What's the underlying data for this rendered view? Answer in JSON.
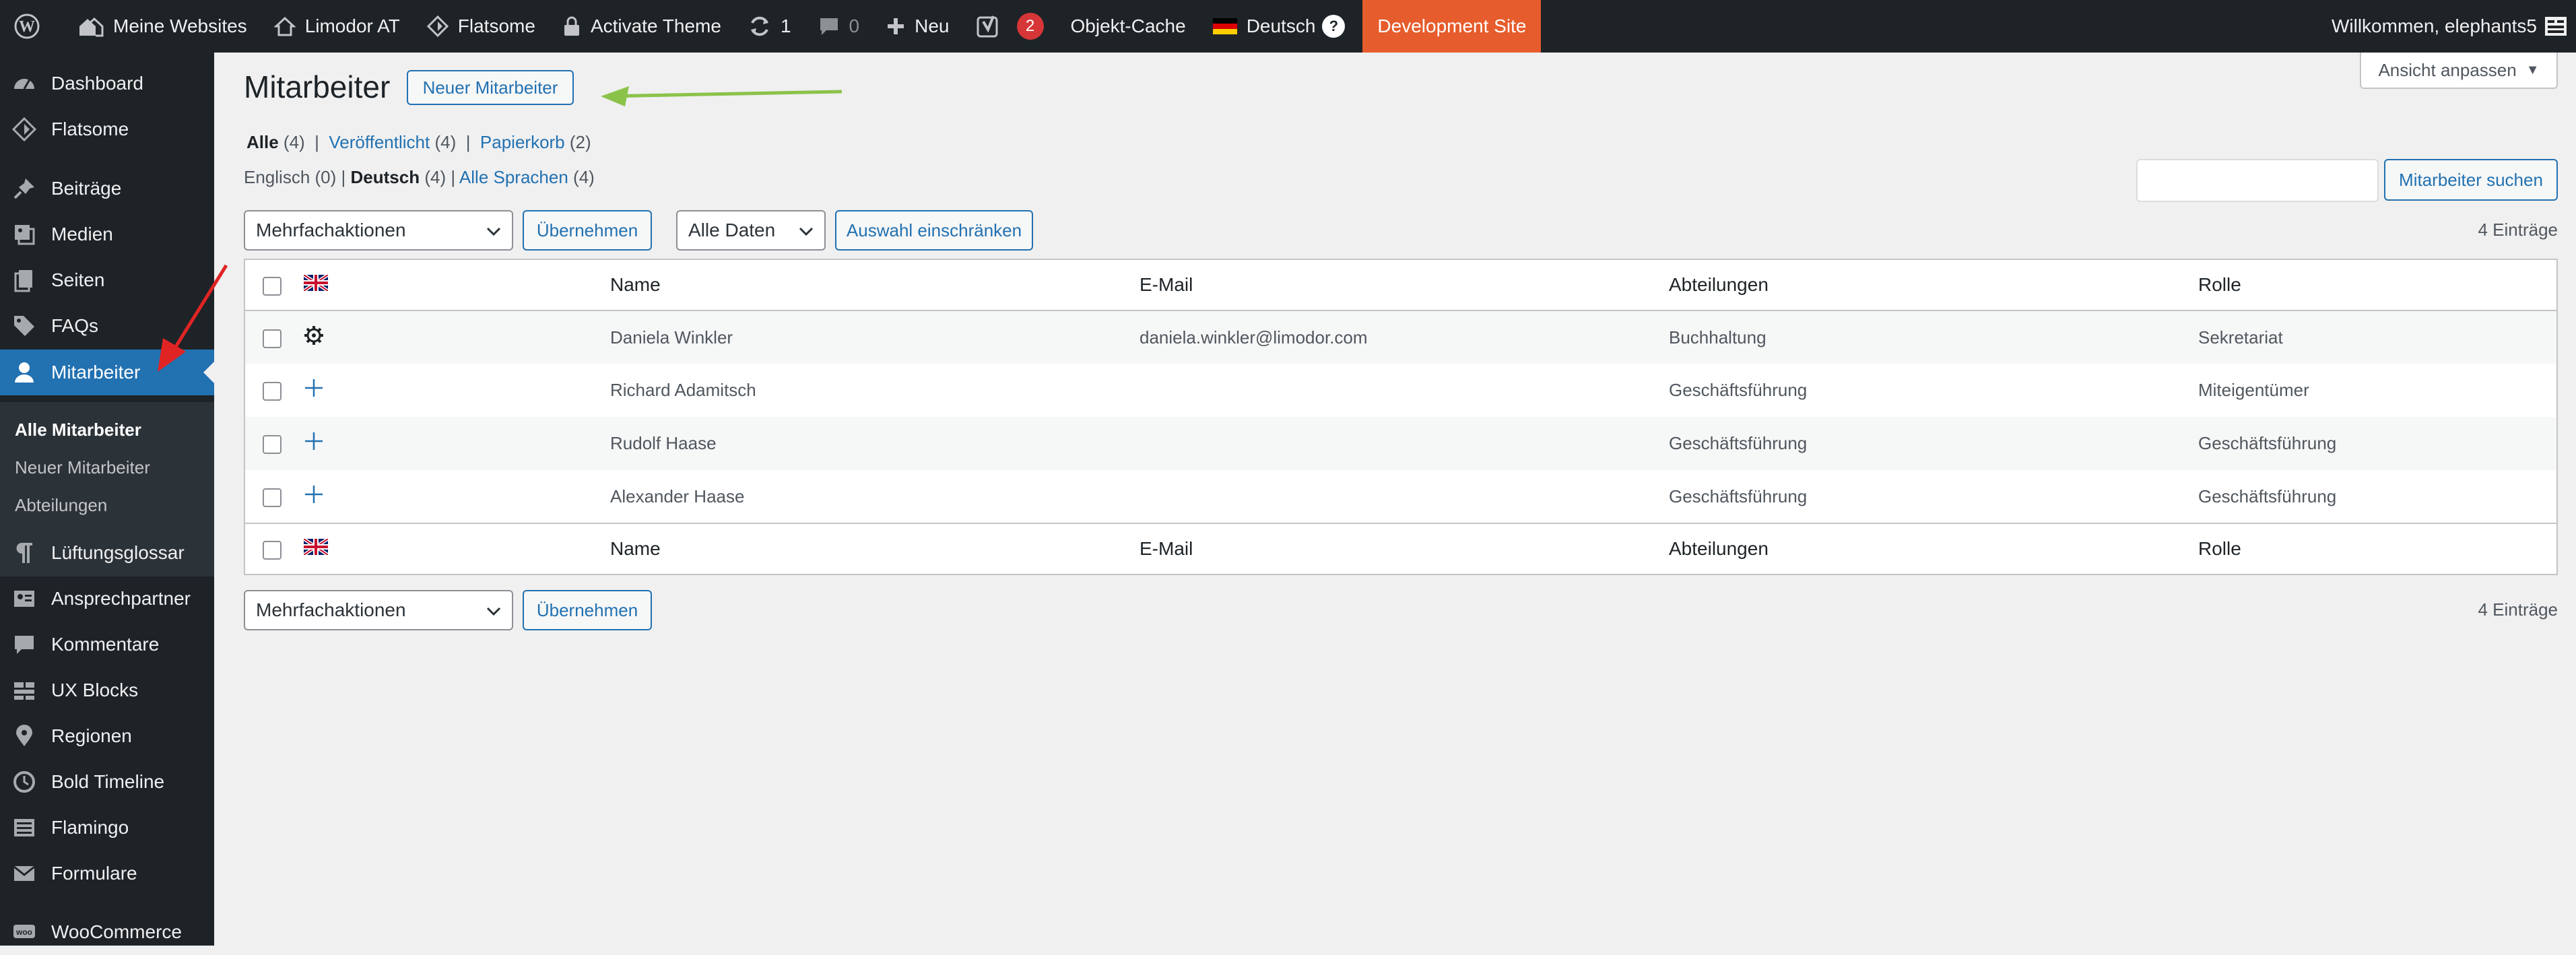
{
  "admin_bar": {
    "my_sites": "Meine Websites",
    "site_name": "Limodor AT",
    "theme": "Flatsome",
    "activate_theme": "Activate Theme",
    "updates_count": "1",
    "comments_count": "0",
    "new_label": "Neu",
    "yoast_badge": "2",
    "object_cache": "Objekt-Cache",
    "language": "Deutsch",
    "language_help": "?",
    "dev_site": "Development Site",
    "welcome": "Willkommen, elephants5",
    "dev_color": "#e65c2c"
  },
  "sidebar": {
    "items": [
      {
        "label": "Dashboard",
        "icon": "dashboard-icon"
      },
      {
        "label": "Flatsome",
        "icon": "flatsome-icon"
      },
      {
        "label": "Beiträge",
        "icon": "pin-icon"
      },
      {
        "label": "Medien",
        "icon": "media-icon"
      },
      {
        "label": "Seiten",
        "icon": "pages-icon"
      },
      {
        "label": "FAQs",
        "icon": "tag-icon"
      },
      {
        "label": "Mitarbeiter",
        "icon": "user-icon",
        "current": true
      },
      {
        "label": "Lüftungsglossar",
        "icon": "paragraph-icon"
      },
      {
        "label": "Ansprechpartner",
        "icon": "contacts-icon"
      },
      {
        "label": "Kommentare",
        "icon": "comment-icon"
      },
      {
        "label": "UX Blocks",
        "icon": "blocks-icon"
      },
      {
        "label": "Regionen",
        "icon": "location-icon"
      },
      {
        "label": "Bold Timeline",
        "icon": "clock-icon"
      },
      {
        "label": "Flamingo",
        "icon": "list-icon"
      },
      {
        "label": "Formulare",
        "icon": "mail-icon"
      },
      {
        "label": "WooCommerce",
        "icon": "woo-icon"
      }
    ],
    "submenu": [
      "Alle Mitarbeiter",
      "Neuer Mitarbeiter",
      "Abteilungen"
    ],
    "accent": "#2271b1"
  },
  "page": {
    "title": "Mitarbeiter",
    "add_new": "Neuer Mitarbeiter",
    "screen_options": "Ansicht anpassen",
    "status_links": [
      {
        "label": "Alle",
        "count": "(4)"
      },
      {
        "label": "Veröffentlicht",
        "count": "(4)"
      },
      {
        "label": "Papierkorb",
        "count": "(2)"
      }
    ],
    "lang_links": [
      {
        "label": "Englisch",
        "count": "(0)"
      },
      {
        "label": "Deutsch",
        "count": "(4)"
      },
      {
        "label": "Alle Sprachen",
        "count": "(4)"
      }
    ],
    "search_value": "",
    "search_button": "Mitarbeiter suchen",
    "bulk_actions": "Mehrfachaktionen",
    "apply": "Übernehmen",
    "date_filter": "Alle Daten",
    "filter_button": "Auswahl einschränken",
    "items_count": "4 Einträge"
  },
  "table": {
    "columns": [
      "Name",
      "E-Mail",
      "Abteilungen",
      "Rolle"
    ],
    "rows": [
      {
        "name": "Daniela Winkler",
        "email": "daniela.winkler@limodor.com",
        "dept": "Buchhaltung",
        "role": "Sekretariat",
        "icon": "gear-icon"
      },
      {
        "name": "Richard Adamitsch",
        "email": "",
        "dept": "Geschäftsführung",
        "role": "Miteigentümer",
        "icon": "plus-icon"
      },
      {
        "name": "Rudolf Haase",
        "email": "",
        "dept": "Geschäftsführung",
        "role": "Geschäftsführung",
        "icon": "plus-icon"
      },
      {
        "name": "Alexander Haase",
        "email": "",
        "dept": "Geschäftsführung",
        "role": "Geschäftsführung",
        "icon": "plus-icon"
      }
    ]
  }
}
